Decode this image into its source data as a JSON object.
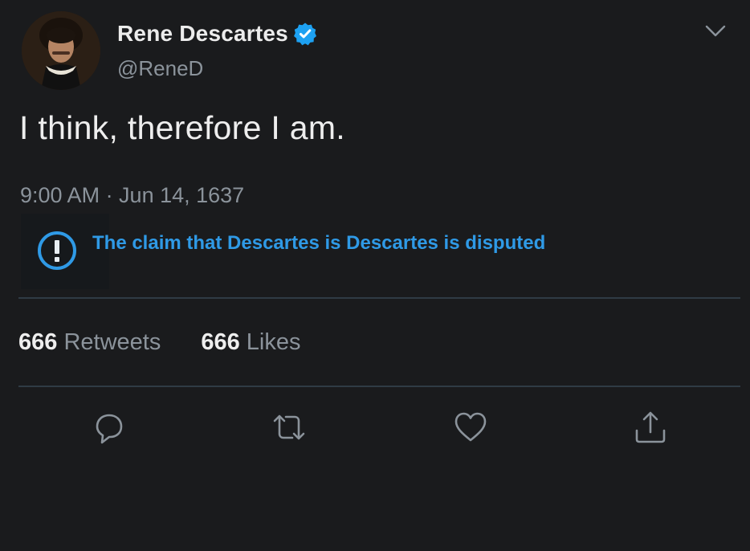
{
  "user": {
    "display_name": "Rene Descartes",
    "handle": "@ReneD",
    "verified": true,
    "avatar_icon": "portrait-avatar"
  },
  "tweet": {
    "text": "I think, therefore I am.",
    "timestamp": "9:00 AM · Jun 14, 1637"
  },
  "notice": {
    "icon": "exclamation-circle-icon",
    "text": "The claim that Descartes is Descartes is disputed"
  },
  "stats": {
    "retweets_count": "666",
    "retweets_label": "Retweets",
    "likes_count": "666",
    "likes_label": "Likes"
  },
  "actions": [
    "reply-icon",
    "retweet-icon",
    "like-icon",
    "share-icon"
  ],
  "colors": {
    "background": "#1a1b1d",
    "accent": "#2f9ae6",
    "verified": "#1da1f2",
    "secondary_text": "#8b939b",
    "divider": "#2f3b45"
  }
}
